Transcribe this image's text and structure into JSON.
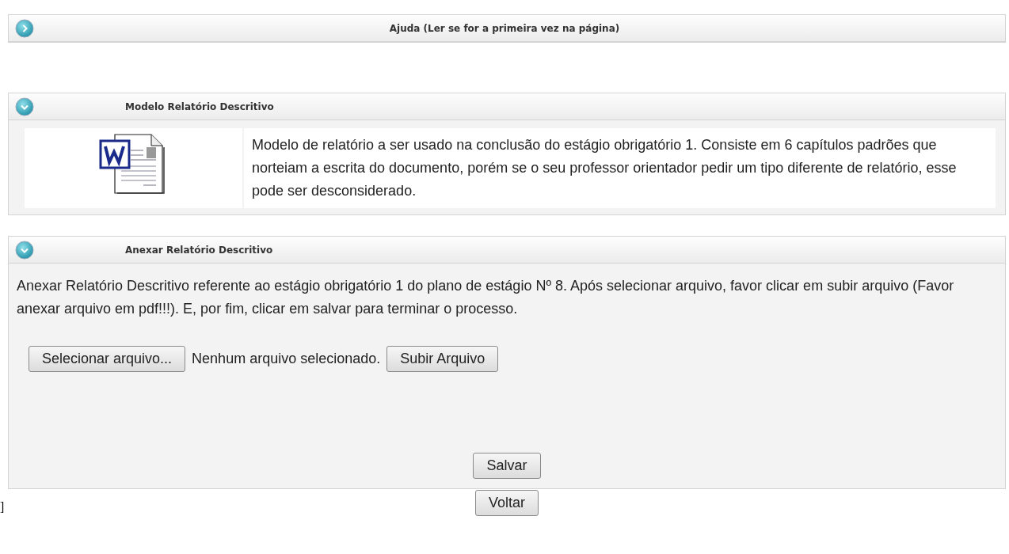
{
  "panels": [
    {
      "title": "Ajuda (Ler se for a primeira vez na página)",
      "expanded": false,
      "kind": "help"
    },
    {
      "title": "Modelo Relatório Descritivo",
      "expanded": true,
      "kind": "document",
      "description": "Modelo de relatório a ser usado na conclusão do estágio obrigatório 1. Consiste em 6 capítulos padrões que norteiam a escrita do documento, porém se o seu professor orientador pedir um tipo diferente de relatório, esse pode ser desconsiderado."
    },
    {
      "title": "Anexar Relatório Descritivo",
      "expanded": true,
      "kind": "upload",
      "instructions": "Anexar Relatório Descritivo referente ao estágio obrigatório 1 do plano de estágio Nº 8. Após selecionar arquivo, favor clicar em subir arquivo (Favor anexar arquivo em pdf!!!). E, por fim, clicar em salvar para terminar o processo.",
      "file_button": "Selecionar arquivo...",
      "file_status": "Nenhum arquivo selecionado.",
      "upload_button": "Subir Arquivo",
      "save_button": "Salvar"
    }
  ],
  "back_button": "Voltar",
  "stray_mark": "]"
}
